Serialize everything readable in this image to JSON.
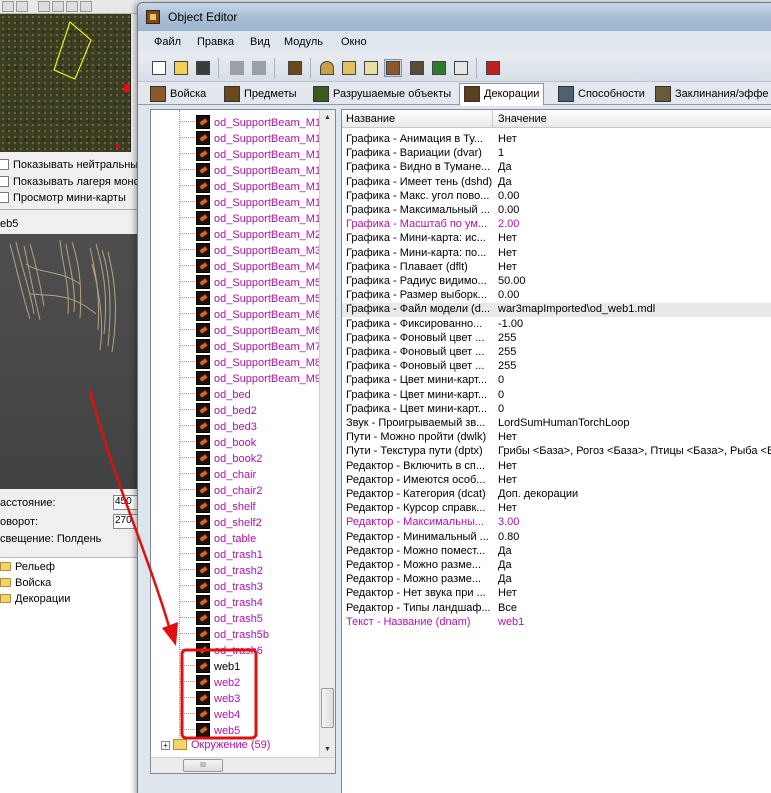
{
  "background_editor": {
    "options": [
      "Показывать нейтральные",
      "Показывать лагеря монс",
      "Просмотр мини-карты"
    ],
    "selected_name": "eb5",
    "props": [
      {
        "label": "асстояние:",
        "value": "450"
      },
      {
        "label": "оворот:",
        "value": "270"
      },
      {
        "label": "свещение: Полдень",
        "value": ""
      }
    ],
    "folders": [
      "Рельеф",
      "Войска",
      "Декорации"
    ]
  },
  "window": {
    "title": "Object Editor",
    "menu": [
      "Файл",
      "Правка",
      "Вид",
      "Модуль",
      "Окно"
    ],
    "tabs": [
      "Войска",
      "Предметы",
      "Разрушаемые объекты",
      "Декорации",
      "Способности",
      "Заклинания/эффе"
    ],
    "active_tab": "Декорации"
  },
  "tree": {
    "items": [
      "od_SupportBeam_M1",
      "od_SupportBeam_M1",
      "od_SupportBeam_M1",
      "od_SupportBeam_M1",
      "od_SupportBeam_M1",
      "od_SupportBeam_M1",
      "od_SupportBeam_M1",
      "od_SupportBeam_M2",
      "od_SupportBeam_M3",
      "od_SupportBeam_M4",
      "od_SupportBeam_M5",
      "od_SupportBeam_M5",
      "od_SupportBeam_M6",
      "od_SupportBeam_M6",
      "od_SupportBeam_M7",
      "od_SupportBeam_M8",
      "od_SupportBeam_M9",
      "od_bed",
      "od_bed2",
      "od_bed3",
      "od_book",
      "od_book2",
      "od_chair",
      "od_chair2",
      "od_shelf",
      "od_shelf2",
      "od_table",
      "od_trash1",
      "od_trash2",
      "od_trash3",
      "od_trash4",
      "od_trash5",
      "od_trash5b",
      "od_trash6",
      "web1",
      "web2",
      "web3",
      "web4",
      "web5"
    ],
    "selected": "web1",
    "folder": "Окружение (59)"
  },
  "grid": {
    "col_name": "Название",
    "col_value": "Значение",
    "rows": [
      {
        "k": "Графика - Анимация в Ту...",
        "v": "Нет",
        "mod": false
      },
      {
        "k": "Графика - Вариации (dvar)",
        "v": "1",
        "mod": false
      },
      {
        "k": "Графика - Видно в Тумане...",
        "v": "Да",
        "mod": false
      },
      {
        "k": "Графика - Имеет тень (dshd)",
        "v": "Да",
        "mod": false
      },
      {
        "k": "Графика - Макс. угол пово...",
        "v": "0.00",
        "mod": false
      },
      {
        "k": "Графика - Максимальный ...",
        "v": "0.00",
        "mod": false
      },
      {
        "k": "Графика - Масштаб по ум...",
        "v": "2.00",
        "mod": true
      },
      {
        "k": "Графика - Мини-карта: ис...",
        "v": "Нет",
        "mod": false
      },
      {
        "k": "Графика - Мини-карта: по...",
        "v": "Нет",
        "mod": false
      },
      {
        "k": "Графика - Плавает (dflt)",
        "v": "Нет",
        "mod": false
      },
      {
        "k": "Графика - Радиус видимо...",
        "v": "50.00",
        "mod": false
      },
      {
        "k": "Графика - Размер выборк...",
        "v": "0.00",
        "mod": false
      },
      {
        "k": "Графика - Файл модели (d...",
        "v": "war3mapImported\\od_web1.mdl",
        "mod": false,
        "hl": true
      },
      {
        "k": "Графика - Фиксированно...",
        "v": "-1.00",
        "mod": false
      },
      {
        "k": "Графика - Фоновый цвет ...",
        "v": "255",
        "mod": false
      },
      {
        "k": "Графика - Фоновый цвет ...",
        "v": "255",
        "mod": false
      },
      {
        "k": "Графика - Фоновый цвет ...",
        "v": "255",
        "mod": false
      },
      {
        "k": "Графика - Цвет мини-карт...",
        "v": "0",
        "mod": false
      },
      {
        "k": "Графика - Цвет мини-карт...",
        "v": "0",
        "mod": false
      },
      {
        "k": "Графика - Цвет мини-карт...",
        "v": "0",
        "mod": false
      },
      {
        "k": "Звук - Проигрываемый зв...",
        "v": "LordSumHumanTorchLoop",
        "mod": false
      },
      {
        "k": "Пути - Можно пройти (dwlk)",
        "v": "Нет",
        "mod": false
      },
      {
        "k": "Пути - Текстура пути (dptx)",
        "v": "Грибы <База>, Рогоз <База>, Птицы <База>, Рыба <Б",
        "mod": false
      },
      {
        "k": "Редактор - Включить в сп...",
        "v": "Нет",
        "mod": false
      },
      {
        "k": "Редактор - Имеются особ...",
        "v": "Нет",
        "mod": false
      },
      {
        "k": "Редактор - Категория (dcat)",
        "v": "Доп. декорации",
        "mod": false
      },
      {
        "k": "Редактор - Курсор справк...",
        "v": "Нет",
        "mod": false
      },
      {
        "k": "Редактор - Максимальны...",
        "v": "3.00",
        "mod": true
      },
      {
        "k": "Редактор - Минимальный ...",
        "v": "0.80",
        "mod": false
      },
      {
        "k": "Редактор - Можно помест...",
        "v": "Да",
        "mod": false
      },
      {
        "k": "Редактор - Можно разме...",
        "v": "Да",
        "mod": false
      },
      {
        "k": "Редактор - Можно разме...",
        "v": "Да",
        "mod": false
      },
      {
        "k": "Редактор - Нет звука при ...",
        "v": "Нет",
        "mod": false
      },
      {
        "k": "Редактор - Типы ландшаф...",
        "v": "Все",
        "mod": false
      },
      {
        "k": "Текст - Название (dnam)",
        "v": "web1",
        "mod": true
      }
    ]
  },
  "colors": {
    "modified": "#b012b0",
    "annotation": "#e01010",
    "titlebar": "#aabfd6"
  }
}
